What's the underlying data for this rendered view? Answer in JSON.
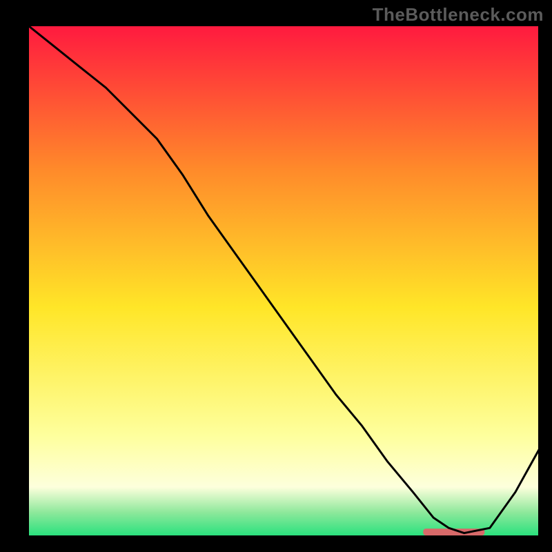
{
  "watermark": "TheBottleneck.com",
  "colors": {
    "red": "#ff1a3f",
    "orange": "#ff8a2a",
    "yellow": "#ffe628",
    "paleYellow": "#feff9d",
    "cream": "#fdffdc",
    "green": "#1ee07a",
    "greenMid": "#8de89b",
    "marker": "#d86a6a",
    "line": "#000000",
    "axis": "#000000"
  },
  "chart_data": {
    "type": "line",
    "title": "",
    "xlabel": "",
    "ylabel": "",
    "xlim": [
      0,
      100
    ],
    "ylim": [
      0,
      100
    ],
    "x": [
      0,
      5,
      10,
      15,
      20,
      25,
      30,
      35,
      40,
      45,
      50,
      55,
      60,
      65,
      70,
      75,
      79,
      82,
      85,
      90,
      95,
      100
    ],
    "y": [
      100,
      96,
      92,
      88,
      83,
      78,
      71,
      63,
      56,
      49,
      42,
      35,
      28,
      22,
      15,
      9,
      4,
      2,
      1,
      2,
      9,
      18
    ],
    "optimal_marker": {
      "x_start": 77,
      "x_end": 89,
      "y": 1.2
    },
    "gradient_stops": [
      {
        "offset": 0.0,
        "color": "#ff1a3f"
      },
      {
        "offset": 0.28,
        "color": "#ff8a2a"
      },
      {
        "offset": 0.55,
        "color": "#ffe628"
      },
      {
        "offset": 0.8,
        "color": "#feff9d"
      },
      {
        "offset": 0.9,
        "color": "#fdffdc"
      },
      {
        "offset": 0.95,
        "color": "#8de89b"
      },
      {
        "offset": 1.0,
        "color": "#1ee07a"
      }
    ]
  }
}
